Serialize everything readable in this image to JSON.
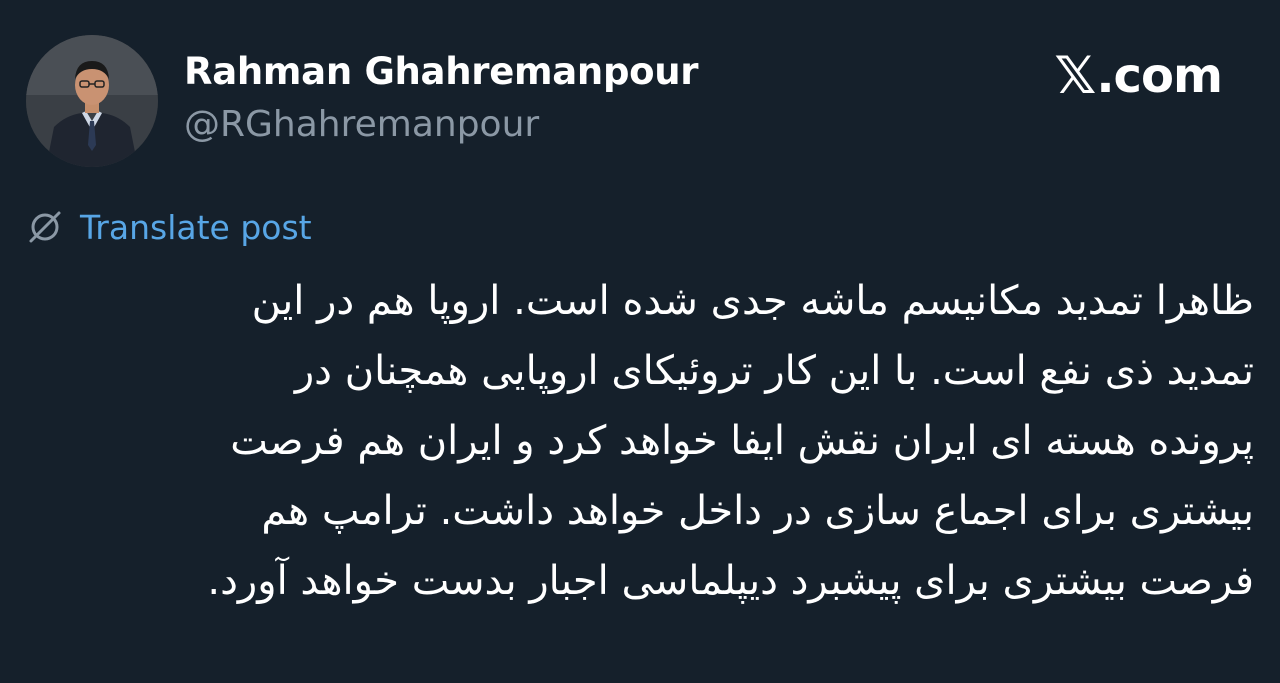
{
  "author": {
    "display_name": "Rahman Ghahremanpour",
    "handle": "@RGhahremanpour",
    "avatar_icon": "person-portrait"
  },
  "brand": {
    "logo_icon": "x-logo-icon",
    "x_glyph": "𝕏",
    "domain_text": ".com"
  },
  "translate": {
    "icon": "globe-slash-icon",
    "label": "Translate post",
    "color": "#58a6e6"
  },
  "post": {
    "lines": [
      "ظاهرا تمدید مکانیسم ماشه جدی شده است. اروپا هم در این",
      "تمدید ذی نفع است. با این کار تروئیکای اروپایی همچنان در",
      "پرونده هسته ای ایران نقش ایفا خواهد کرد و ایران هم فرصت",
      "بیشتری برای اجماع سازی در داخل خواهد داشت. ترامپ هم",
      "فرصت بیشتری برای پیشبرد دیپلماسی اجبار بدست خواهد آورد."
    ]
  },
  "colors": {
    "background": "#15202b",
    "text_primary": "#ffffff",
    "text_secondary": "#8b98a5",
    "link": "#58a6e6"
  }
}
